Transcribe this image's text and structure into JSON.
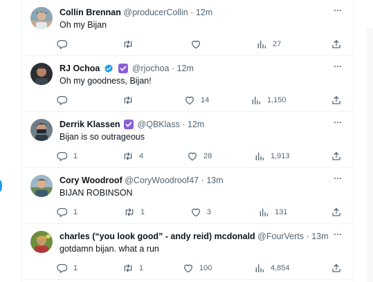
{
  "colors": {
    "verified_blue": "#1d9bf0",
    "verified_purple": "#8a5fd6",
    "muted": "#536471",
    "text": "#0f1419"
  },
  "icons": {
    "reply": "reply-icon",
    "retweet": "retweet-icon",
    "like": "heart-icon",
    "views": "views-icon",
    "share": "share-icon",
    "more": "more-icon"
  },
  "tweets": [
    {
      "name": "Collin Brennan",
      "handle": "@producerCollin",
      "dot": "·",
      "time": "12m",
      "text": "Oh my Bijan",
      "replies": "",
      "retweets": "",
      "likes": "",
      "views": "27",
      "badges": []
    },
    {
      "name": "RJ Ochoa",
      "handle": "@rjochoa",
      "dot": "·",
      "time": "12m",
      "text": "Oh my goodness, Bijan!",
      "replies": "",
      "retweets": "",
      "likes": "14",
      "views": "1,150",
      "badges": [
        "blue",
        "purple"
      ]
    },
    {
      "name": "Derrik Klassen",
      "handle": "@QBKlass",
      "dot": "·",
      "time": "12m",
      "text": "Bijan is so outrageous",
      "replies": "1",
      "retweets": "4",
      "likes": "28",
      "views": "1,913",
      "badges": [
        "purple"
      ]
    },
    {
      "name": "Cory Woodroof",
      "handle": "@CoryWoodroof47",
      "dot": "·",
      "time": "13m",
      "text": "BIJAN ROBINSON",
      "replies": "1",
      "retweets": "1",
      "likes": "3",
      "views": "131",
      "badges": []
    },
    {
      "name": "charles (“you look good” - andy reid) mcdonald",
      "handle": "@FourVerts",
      "dot": "·",
      "time": "13m",
      "text": "gotdamn bijan. what a run",
      "replies": "1",
      "retweets": "1",
      "likes": "100",
      "views": "4,854",
      "badges": []
    }
  ]
}
